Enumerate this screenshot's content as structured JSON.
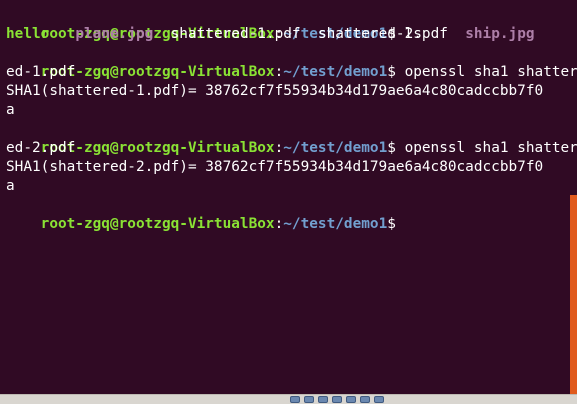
{
  "prompt": {
    "user_host": "root-zgq@rootzgq-VirtualBox",
    "colon": ":",
    "path": "~/test/demo1",
    "symbol": "$"
  },
  "commands": {
    "ls": " ls",
    "sha1_a_part1": " openssl sha1 shatter",
    "sha1_a_part2": "ed-1.pdf",
    "sha1_b_part1": " openssl sha1 shatter",
    "sha1_b_part2": "ed-2.pdf"
  },
  "ls_output": {
    "hello": "hello",
    "plane": "plane.jpg",
    "shattered1": "shattered-1.pdf",
    "shattered2": "shattered-2.pdf",
    "ship": "ship.jpg"
  },
  "outputs": {
    "hash_a_part1": "SHA1(shattered-1.pdf)= 38762cf7f55934b34d179ae6a4c80cadccbb7f0",
    "hash_a_part2": "a",
    "hash_b_part1": "SHA1(shattered-2.pdf)= 38762cf7f55934b34d179ae6a4c80cadccbb7f0",
    "hash_b_part2": "a"
  },
  "colors": {
    "background": "#300a24",
    "prompt_user": "#8ae234",
    "prompt_path": "#729fcf",
    "image_file": "#ad7fa8",
    "scrollbar": "#e05a1c"
  },
  "tray_icons": [
    "network-icon",
    "usb-icon",
    "shared-folder-icon",
    "display-icon",
    "capture-icon",
    "audio-icon",
    "keyboard-icon"
  ]
}
